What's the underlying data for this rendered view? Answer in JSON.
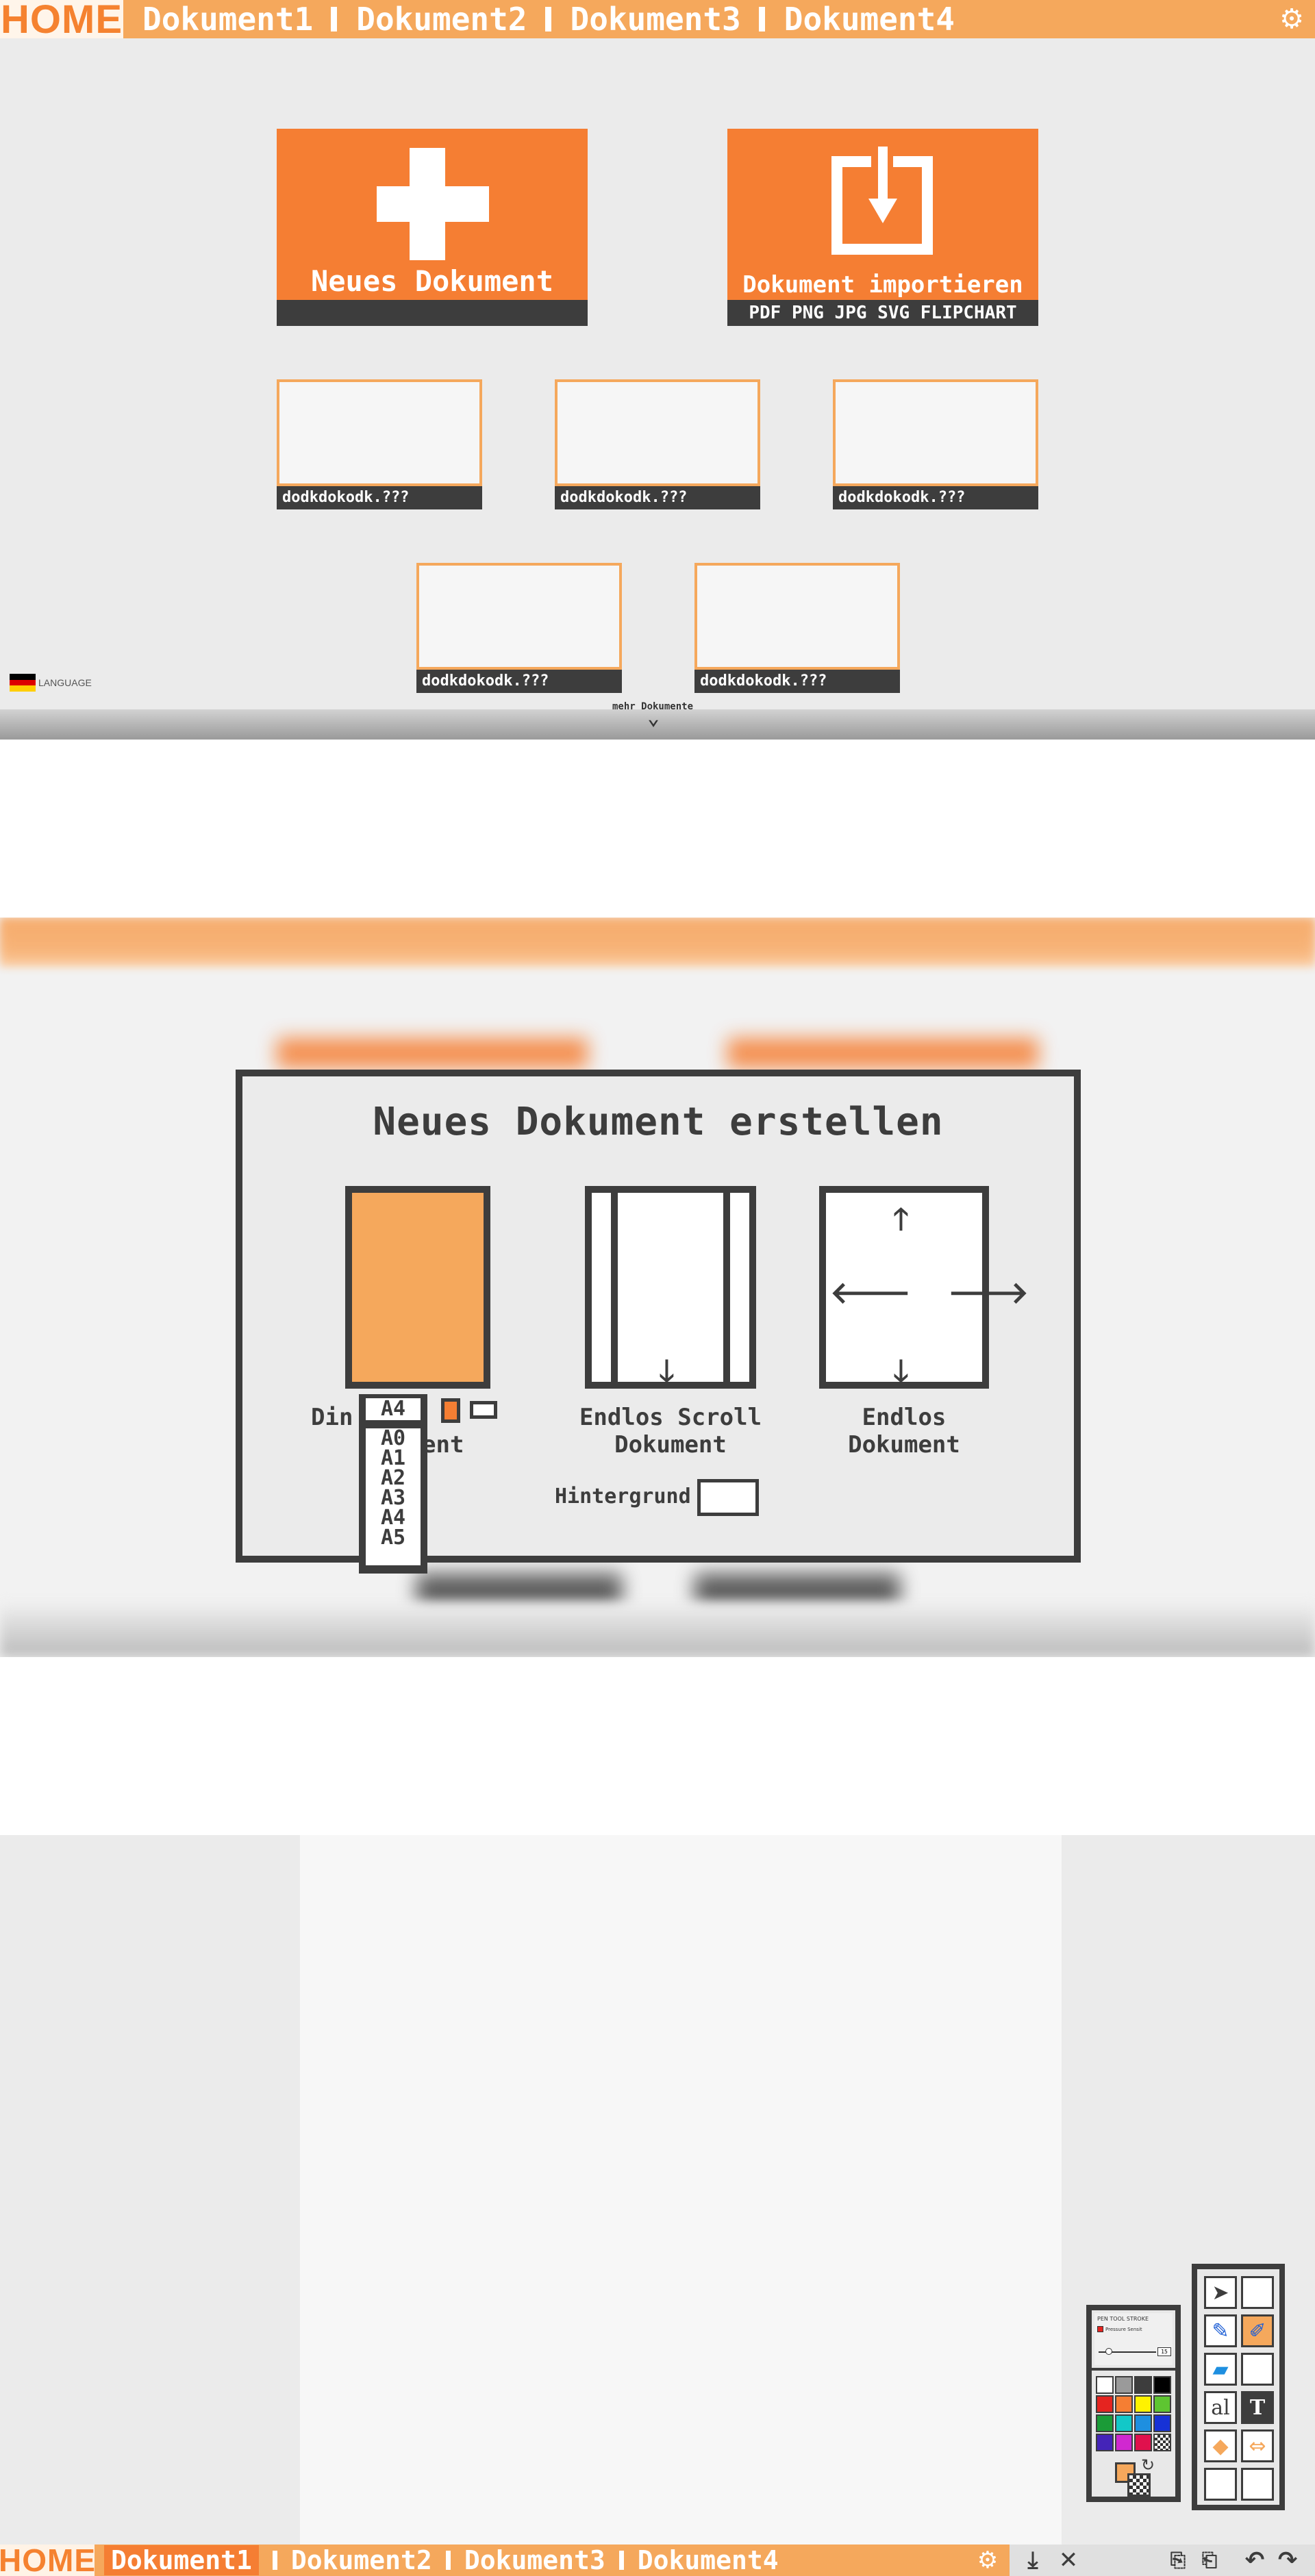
{
  "home": {
    "home_label": "HOME",
    "tabs": [
      "Dokument1",
      "Dokument2",
      "Dokument3",
      "Dokument4"
    ],
    "settings_icon": "gear-icon",
    "new_document": {
      "label": "Neues Dokument"
    },
    "import_document": {
      "label": "Dokument importieren",
      "formats": "PDF PNG JPG SVG FLIPCHART"
    },
    "recent_documents": [
      "dodkdokodk.???",
      "dodkdokodk.???",
      "dodkdokodk.???",
      "dodkdokodk.???",
      "dodkdokodk.???"
    ],
    "language_label": "LANGUAGE",
    "more_label": "mehr Dokumente"
  },
  "dialog": {
    "title": "Neues Dokument erstellen",
    "options": [
      {
        "label": "Din\nDokument",
        "selected": true
      },
      {
        "label": "Endlos Scroll\nDokument",
        "selected": false
      },
      {
        "label": "Endlos\nDokument",
        "selected": false
      }
    ],
    "din_label_part1": "Din",
    "din_label_part2": "ent",
    "scroll_label_line1": "Endlos Scroll",
    "scroll_label_line2": "Dokument",
    "endless_label_line1": "Endlos",
    "endless_label_line2": "Dokument",
    "paper_size": "A4",
    "paper_sizes": [
      "A0",
      "A1",
      "A2",
      "A3",
      "A4",
      "A5"
    ],
    "background_label": "Hintergrund",
    "colors": {
      "accent": "#f57e33",
      "frame": "#3d3d3d",
      "selected_fill": "#f5a85c"
    }
  },
  "editor": {
    "home_label": "HOME",
    "tabs": [
      "Dokument1",
      "Dokument2",
      "Dokument3",
      "Dokument4"
    ],
    "active_tab": "Dokument1",
    "pen_panel_title": "PEN TOOL STROKE",
    "pen_panel_option": "Pressure Sensit",
    "stroke_value": "15",
    "swatches": [
      "#ffffff",
      "#9a9a9a",
      "#3d3d3d",
      "#000000",
      "#e52420",
      "#f57e33",
      "#fff200",
      "#5ec531",
      "#1b9b37",
      "#12c8c8",
      "#1e8fe0",
      "#1732d6",
      "#4424b8",
      "#d028d0",
      "#e0114d",
      "transparent"
    ],
    "text_tool_label": "al"
  }
}
